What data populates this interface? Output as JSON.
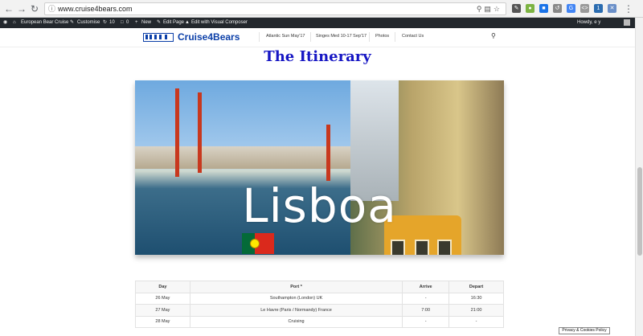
{
  "browser": {
    "url": "www.cruise4bears.com",
    "ext_badge": "1"
  },
  "adminbar": {
    "site": "European Bear Cruise",
    "customise": "Customise",
    "updates": "10",
    "comments": "0",
    "new": "New",
    "edit_page": "Edit Page",
    "edit_visual": "Edit with Visual Composer",
    "howdy": "Howdy, e y"
  },
  "site": {
    "logo_text": "Cruise4Bears",
    "menu": [
      "Atlantic Sun May'17",
      "Singes Med 10-17 Sep'17",
      "Photos",
      "Contact Us"
    ]
  },
  "page": {
    "title": "The Itinerary",
    "hero_text": "Lisboa"
  },
  "itinerary": {
    "headers": [
      "Day",
      "Port *",
      "Arrive",
      "Depart"
    ],
    "rows": [
      [
        "26 May",
        "Southampton (London) UK",
        "-",
        "16:30"
      ],
      [
        "27 May",
        "Le Havre (Paris / Normandy) France",
        "7:00",
        "21:00"
      ],
      [
        "28 May",
        "Cruising",
        "-",
        "-"
      ]
    ]
  },
  "cookie_policy": "Privacy & Cookies Policy"
}
